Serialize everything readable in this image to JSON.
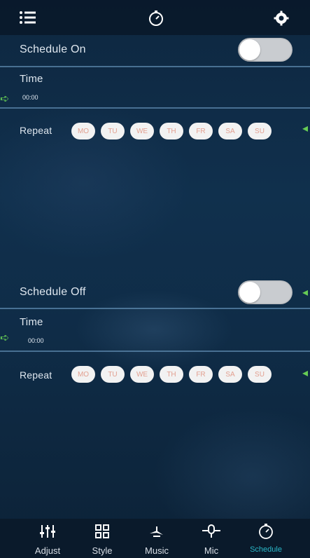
{
  "header": {
    "menu_icon": "list-icon",
    "center_icon": "timer-icon",
    "right_icon": "settings-icon"
  },
  "schedule_on": {
    "label": "Schedule On",
    "toggle_on": false,
    "time_label": "Time",
    "time_value": "00:00",
    "repeat_label": "Repeat",
    "days": [
      "MO",
      "TU",
      "WE",
      "TH",
      "FR",
      "SA",
      "SU"
    ]
  },
  "schedule_off": {
    "label": "Schedule Off",
    "toggle_on": false,
    "time_label": "Time",
    "time_value": "00:00",
    "repeat_label": "Repeat",
    "days": [
      "MO",
      "TU",
      "WE",
      "TH",
      "FR",
      "SA",
      "SU"
    ]
  },
  "tabs": [
    {
      "label": "Adjust",
      "icon": "equalizer-icon"
    },
    {
      "label": "Style",
      "icon": "grid-icon"
    },
    {
      "label": "Music",
      "icon": "music-icon"
    },
    {
      "label": "Mic",
      "icon": "microphone-icon"
    },
    {
      "label": "Schedule",
      "icon": "timer-icon",
      "active": true
    }
  ],
  "colors": {
    "active_tab": "#2ab8c8",
    "day_text": "#e2a090",
    "divider": "#78aad2",
    "arrow": "#66cc55"
  }
}
